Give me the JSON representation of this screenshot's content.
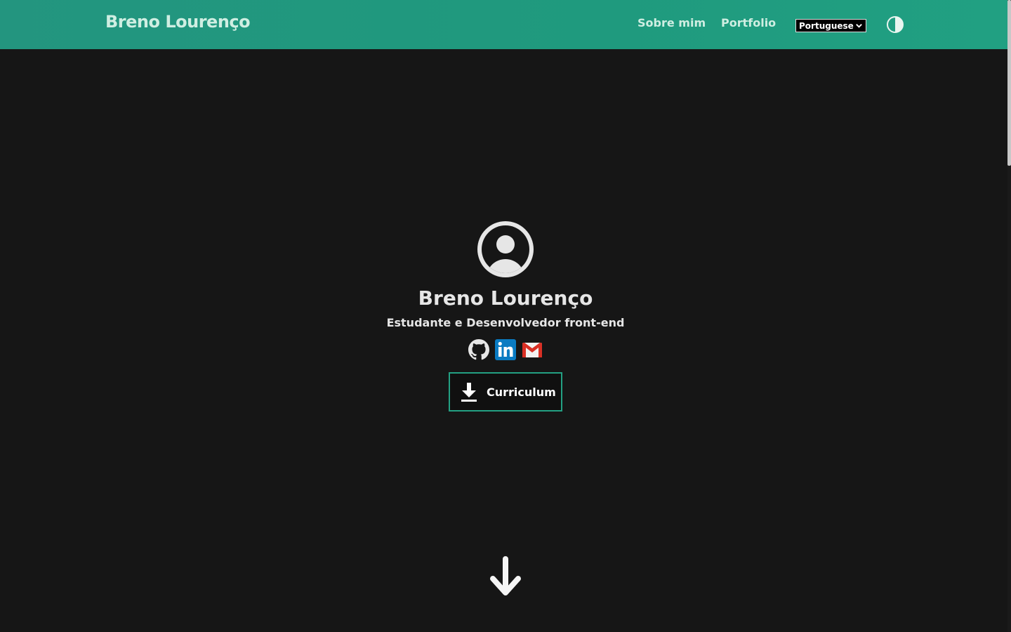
{
  "header": {
    "brand": "Breno Lourenço",
    "nav": [
      {
        "label": "Sobre mim"
      },
      {
        "label": "Portfolio"
      }
    ],
    "language": {
      "selected": "Portuguese"
    },
    "theme_toggle_icon": "half-circle-icon",
    "background": "#1f9a7e"
  },
  "hero": {
    "avatar_icon": "user-circle-icon",
    "name": "Breno Lourenço",
    "subtitle": "Estudante e Desenvolvedor front-end",
    "social": [
      {
        "icon": "github-icon"
      },
      {
        "icon": "linkedin-icon"
      },
      {
        "icon": "gmail-icon"
      }
    ],
    "cv_button": {
      "label": "Curriculum",
      "icon": "download-icon",
      "border_color": "#23a083"
    }
  },
  "scroll_hint_icon": "arrow-down-icon",
  "colors": {
    "background": "#161616",
    "accent": "#1f9a7e"
  }
}
